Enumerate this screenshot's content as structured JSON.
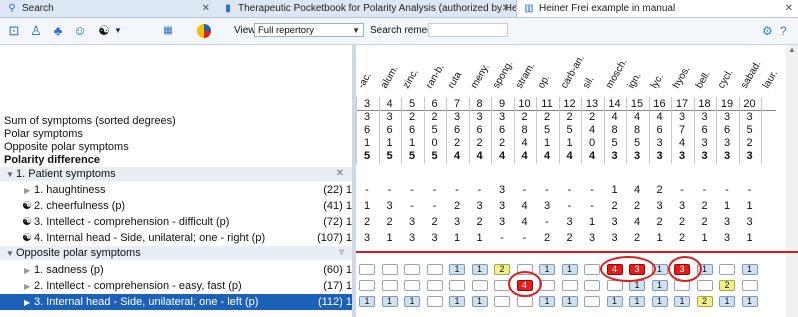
{
  "tabs": [
    {
      "icon": "search-icon",
      "label": "Search",
      "active": false
    },
    {
      "icon": "book-icon",
      "label": "Therapeutic Pocketbook for Polarity Analysis (authorized by Heiner Frei)...",
      "active": false
    },
    {
      "icon": "bar-chart-icon",
      "label": "Heiner Frei example in manual",
      "active": true
    }
  ],
  "toolbar": {
    "views_label": "Views:",
    "views_value": "Full repertory",
    "search_label": "Search remedy:",
    "search_placeholder": ""
  },
  "summary": {
    "sum": "Sum of symptoms (sorted degrees)",
    "polar": "Polar symptoms",
    "opposite": "Opposite polar symptoms",
    "difference": "Polarity difference"
  },
  "groups": {
    "patient": "1. Patient symptoms",
    "opposite": "Opposite polar symptoms"
  },
  "patient_symptoms": [
    {
      "label": "1. haughtiness",
      "count": "(22) 1",
      "polar": false
    },
    {
      "label": "2. cheerfulness (p)",
      "count": "(41) 1",
      "polar": true
    },
    {
      "label": "3. Intellect - comprehension - difficult (p)",
      "count": "(72) 1",
      "polar": true
    },
    {
      "label": "4. Internal head - Side, unilateral; one - right (p)",
      "count": "(107) 1",
      "polar": true
    }
  ],
  "opposite_symptoms": [
    {
      "label": "1. sadness (p)",
      "count": "(60) 1"
    },
    {
      "label": "2. Intellect - comprehension - easy, fast (p)",
      "count": "(17) 1"
    },
    {
      "label": "3. Internal head - Side, unilateral; one - left (p)",
      "count": "(112) 1"
    }
  ],
  "remedies": [
    "-ac.",
    "alum.",
    "zinc.",
    "ran-b.",
    "ruta",
    "meny.",
    "spong.",
    "stram.",
    "op.",
    "carb-an.",
    "sil.",
    "mosch.",
    "ign.",
    "lyc.",
    "hyos.",
    "bell.",
    "cycl.",
    "sabad.",
    "laur."
  ],
  "col_numbers": [
    "3",
    "4",
    "5",
    "6",
    "7",
    "8",
    "9",
    "10",
    "11",
    "12",
    "13",
    "14",
    "15",
    "16",
    "17",
    "18",
    "19",
    "20"
  ],
  "rows": {
    "sum": [
      "3",
      "3",
      "2",
      "2",
      "3",
      "3",
      "3",
      "2",
      "2",
      "2",
      "2",
      "4",
      "4",
      "4",
      "3",
      "3",
      "3",
      "3"
    ],
    "polar": [
      "6",
      "6",
      "6",
      "5",
      "6",
      "6",
      "6",
      "8",
      "5",
      "5",
      "4",
      "8",
      "8",
      "6",
      "7",
      "6",
      "6",
      "5"
    ],
    "opposite": [
      "1",
      "1",
      "1",
      "0",
      "2",
      "2",
      "2",
      "4",
      "1",
      "1",
      "0",
      "5",
      "5",
      "3",
      "4",
      "3",
      "3",
      "2"
    ],
    "difference": [
      "5",
      "5",
      "5",
      "5",
      "4",
      "4",
      "4",
      "4",
      "4",
      "4",
      "4",
      "3",
      "3",
      "3",
      "3",
      "3",
      "3",
      "3"
    ]
  },
  "symptom_values": [
    [
      "-",
      "-",
      "-",
      "-",
      "-",
      "-",
      "3",
      "-",
      "-",
      "-",
      "-",
      "1",
      "4",
      "2",
      "-",
      "-",
      "-",
      "-"
    ],
    [
      "1",
      "3",
      "-",
      "-",
      "2",
      "3",
      "3",
      "4",
      "3",
      "-",
      "-",
      "2",
      "2",
      "3",
      "3",
      "2",
      "1",
      "1"
    ],
    [
      "2",
      "2",
      "3",
      "2",
      "3",
      "2",
      "3",
      "4",
      "-",
      "3",
      "1",
      "3",
      "4",
      "2",
      "2",
      "2",
      "3",
      "3"
    ],
    [
      "3",
      "1",
      "3",
      "3",
      "1",
      "1",
      "-",
      "-",
      "2",
      "2",
      "3",
      "3",
      "2",
      "1",
      "2",
      "1",
      "3",
      "1"
    ]
  ],
  "opposite_boxes": [
    [
      [
        "",
        ""
      ],
      [
        "",
        ""
      ],
      [
        "",
        ""
      ],
      [
        "",
        ""
      ],
      [
        "1",
        "blue"
      ],
      [
        "1",
        "blue"
      ],
      [
        "2",
        "yellow"
      ],
      [
        "",
        ""
      ],
      [
        "1",
        "blue"
      ],
      [
        "1",
        "blue"
      ],
      [
        "",
        ""
      ],
      [
        "4",
        "red"
      ],
      [
        "3",
        "red"
      ],
      [
        "1",
        "blue"
      ],
      [
        "3",
        "red"
      ],
      [
        "1",
        "blue"
      ],
      [
        "",
        ""
      ],
      [
        "1",
        "blue"
      ]
    ],
    [
      [
        "",
        ""
      ],
      [
        "",
        ""
      ],
      [
        "",
        ""
      ],
      [
        "",
        ""
      ],
      [
        "",
        ""
      ],
      [
        "",
        ""
      ],
      [
        "",
        ""
      ],
      [
        "4",
        "red"
      ],
      [
        "",
        ""
      ],
      [
        "",
        ""
      ],
      [
        "",
        ""
      ],
      [
        "",
        ""
      ],
      [
        "1",
        "blue"
      ],
      [
        "1",
        "blue"
      ],
      [
        "",
        ""
      ],
      [
        "",
        ""
      ],
      [
        "2",
        "yellow"
      ],
      [
        "",
        ""
      ]
    ],
    [
      [
        "1",
        "blue"
      ],
      [
        "1",
        "blue"
      ],
      [
        "1",
        "blue"
      ],
      [
        "",
        ""
      ],
      [
        "1",
        "blue"
      ],
      [
        "1",
        "blue"
      ],
      [
        "",
        ""
      ],
      [
        "",
        ""
      ],
      [
        "1",
        "blue"
      ],
      [
        "1",
        "blue"
      ],
      [
        "",
        ""
      ],
      [
        "1",
        "blue"
      ],
      [
        "1",
        "blue"
      ],
      [
        "1",
        "blue"
      ],
      [
        "1",
        "blue"
      ],
      [
        "2",
        "yellow"
      ],
      [
        "1",
        "blue"
      ],
      [
        "1",
        "blue"
      ]
    ]
  ],
  "colors": {
    "accent": "#1c61b8",
    "highlight": "#e11d1d",
    "polar_box": "#cfe0f1",
    "yellow_box": "#f1f08a"
  }
}
